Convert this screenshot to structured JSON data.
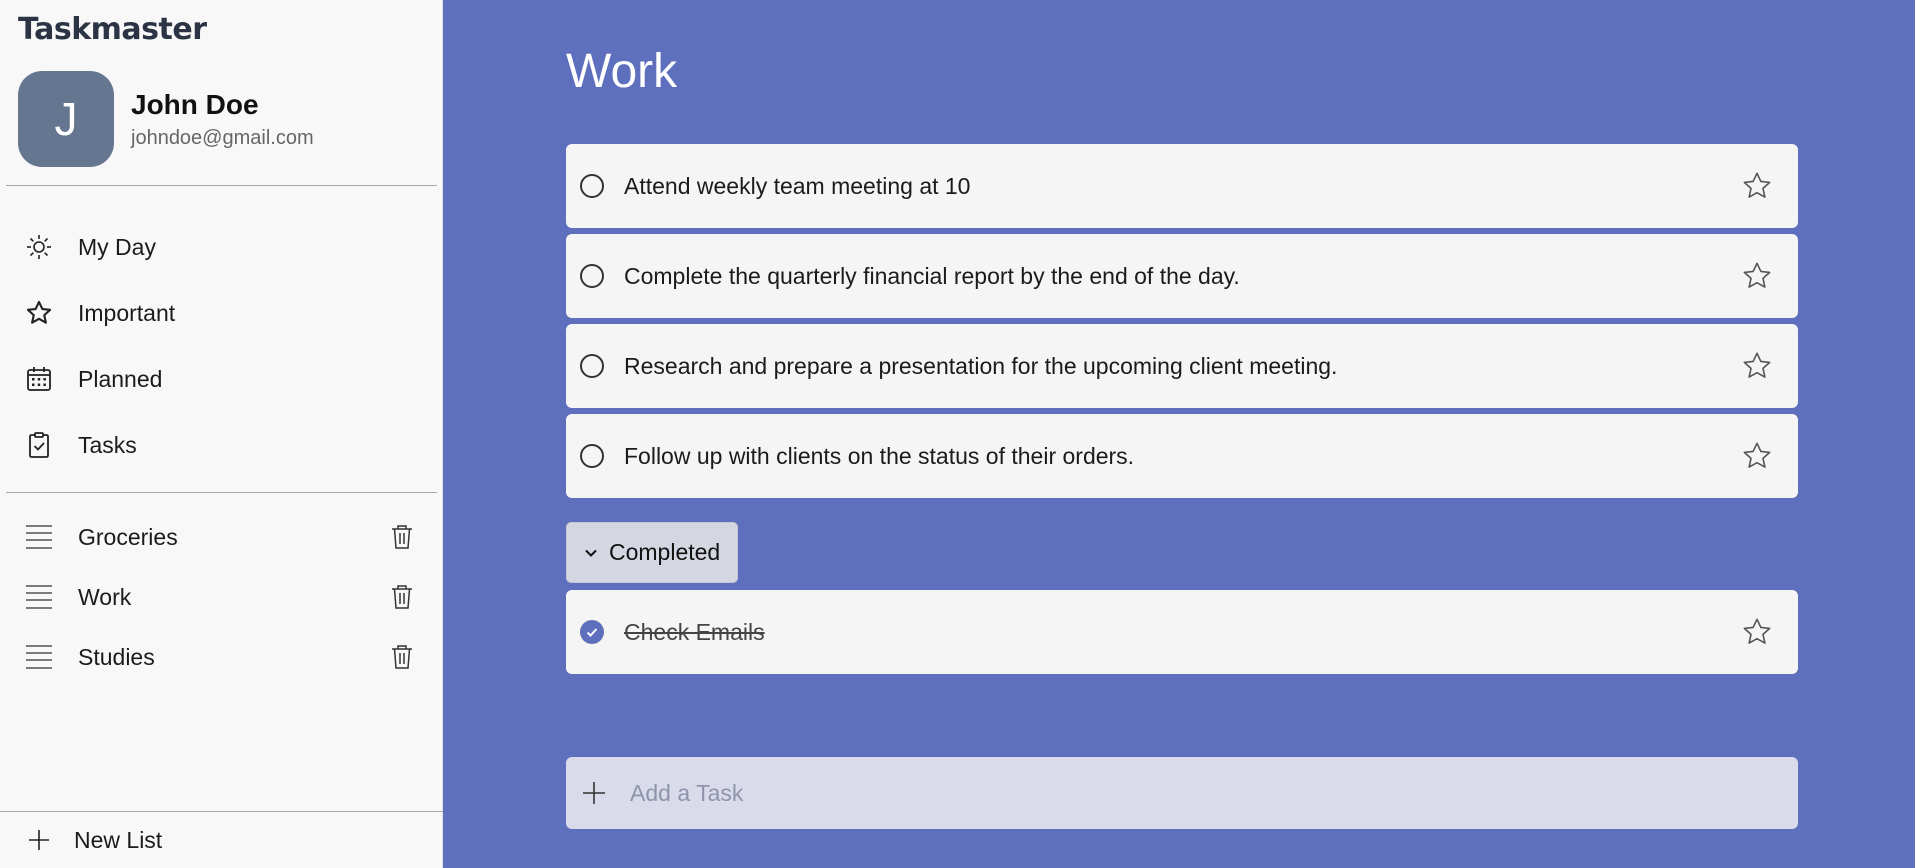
{
  "app": {
    "brand": "Taskmaster"
  },
  "user": {
    "initial": "J",
    "name": "John Doe",
    "email": "johndoe@gmail.com"
  },
  "nav": [
    {
      "label": "My Day",
      "icon": "sun-icon"
    },
    {
      "label": "Important",
      "icon": "star-icon"
    },
    {
      "label": "Planned",
      "icon": "calendar-icon"
    },
    {
      "label": "Tasks",
      "icon": "clipboard-check-icon"
    }
  ],
  "lists": [
    {
      "label": "Groceries",
      "icon": "list-lines-icon"
    },
    {
      "label": "Work",
      "icon": "list-lines-icon"
    },
    {
      "label": "Studies",
      "icon": "list-lines-icon"
    }
  ],
  "new_list": {
    "label": "New List"
  },
  "main": {
    "title": "Work",
    "tasks": [
      {
        "text": "Attend weekly team meeting at 10",
        "completed": false
      },
      {
        "text": "Complete the quarterly financial report by the end of the day.",
        "completed": false
      },
      {
        "text": "Research and prepare a presentation for the upcoming client meeting.",
        "completed": false
      },
      {
        "text": "Follow up with clients on the status of their orders.",
        "completed": false
      }
    ],
    "completed_label": "Completed",
    "completed_tasks": [
      {
        "text": "Check Emails",
        "completed": true
      }
    ],
    "add_task_placeholder": "Add a Task"
  },
  "colors": {
    "accent": "#5e70bd",
    "sidebar_bg": "#f8f8f8",
    "avatar_bg": "#657691"
  }
}
